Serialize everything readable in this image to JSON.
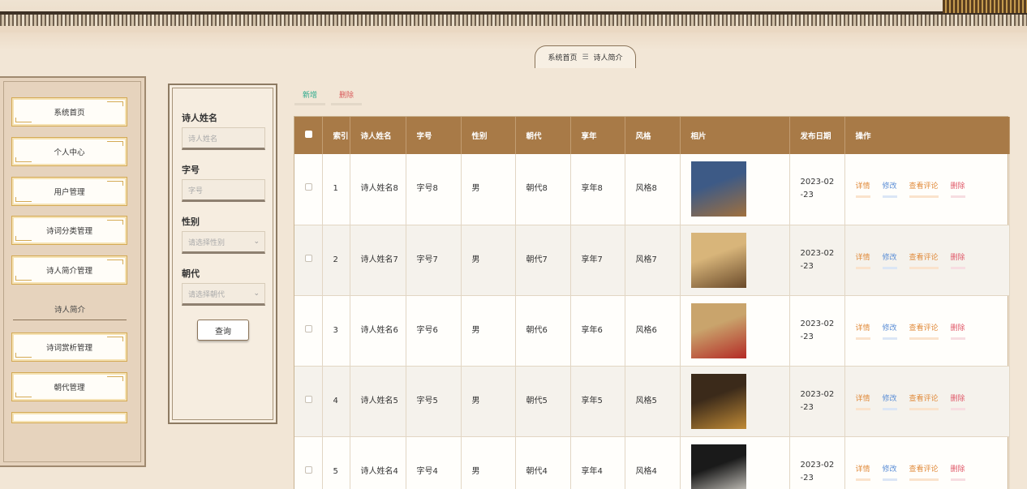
{
  "breadcrumb": {
    "home": "系统首页",
    "separator": "☰",
    "current": "诗人简介"
  },
  "sidebar": {
    "items": [
      "系统首页",
      "个人中心",
      "用户管理",
      "诗词分类管理",
      "诗人简介管理"
    ],
    "section_title": "诗人简介",
    "items2": [
      "诗词赏析管理",
      "朝代管理"
    ]
  },
  "search": {
    "name_label": "诗人姓名",
    "name_placeholder": "诗人姓名",
    "alias_label": "字号",
    "alias_placeholder": "字号",
    "gender_label": "性别",
    "gender_placeholder": "请选择性别",
    "dynasty_label": "朝代",
    "dynasty_placeholder": "请选择朝代",
    "query_button": "查询"
  },
  "actions": {
    "add": "新增",
    "delete": "删除"
  },
  "table": {
    "headers": [
      "",
      "索引",
      "诗人姓名",
      "字号",
      "性别",
      "朝代",
      "享年",
      "风格",
      "相片",
      "发布日期",
      "操作"
    ],
    "rows": [
      {
        "index": "1",
        "name": "诗人姓名8",
        "alias": "字号8",
        "gender": "男",
        "dynasty": "朝代8",
        "age": "享年8",
        "style": "风格8",
        "date": "2023-02-23",
        "photo_colors": [
          "#3d5a86",
          "#a0703e"
        ]
      },
      {
        "index": "2",
        "name": "诗人姓名7",
        "alias": "字号7",
        "gender": "男",
        "dynasty": "朝代7",
        "age": "享年7",
        "style": "风格7",
        "date": "2023-02-23",
        "photo_colors": [
          "#d8b57a",
          "#6a4a2a"
        ]
      },
      {
        "index": "3",
        "name": "诗人姓名6",
        "alias": "字号6",
        "gender": "男",
        "dynasty": "朝代6",
        "age": "享年6",
        "style": "风格6",
        "date": "2023-02-23",
        "photo_colors": [
          "#c9a46c",
          "#b42a26"
        ]
      },
      {
        "index": "4",
        "name": "诗人姓名5",
        "alias": "字号5",
        "gender": "男",
        "dynasty": "朝代5",
        "age": "享年5",
        "style": "风格5",
        "date": "2023-02-23",
        "photo_colors": [
          "#3b2a1a",
          "#c08a36"
        ]
      },
      {
        "index": "5",
        "name": "诗人姓名4",
        "alias": "字号4",
        "gender": "男",
        "dynasty": "朝代4",
        "age": "享年4",
        "style": "风格4",
        "date": "2023-02-23",
        "photo_colors": [
          "#1a1a1a",
          "#e8e4dc"
        ]
      }
    ],
    "ops": {
      "detail": "详情",
      "edit": "修改",
      "comment": "查看评论",
      "delete": "删除"
    }
  },
  "colors": {
    "header_bg": "#a87a47",
    "accent_gold": "#d4aa55",
    "add": "#2aa98c",
    "delete": "#d95b5b"
  }
}
